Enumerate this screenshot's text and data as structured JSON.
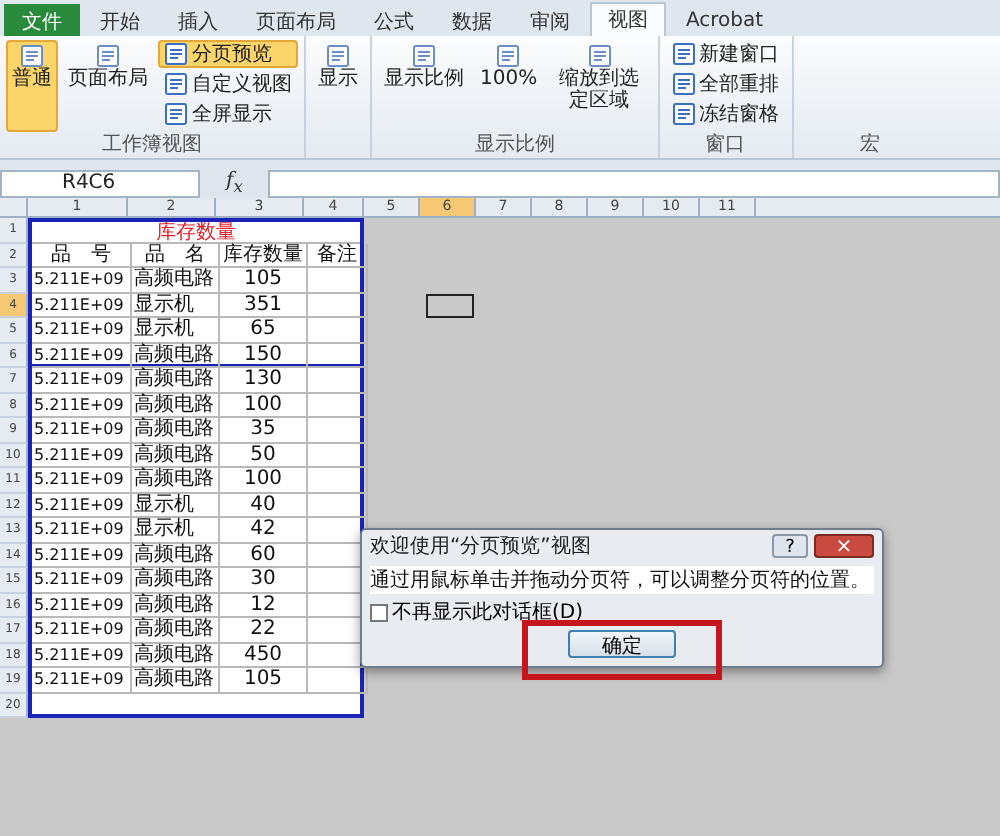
{
  "tabs": [
    {
      "label": "文件",
      "kind": "file",
      "selected": false
    },
    {
      "label": "开始",
      "kind": "tab",
      "selected": false
    },
    {
      "label": "插入",
      "kind": "tab",
      "selected": false
    },
    {
      "label": "页面布局",
      "kind": "tab",
      "selected": false
    },
    {
      "label": "公式",
      "kind": "tab",
      "selected": false
    },
    {
      "label": "数据",
      "kind": "tab",
      "selected": false
    },
    {
      "label": "审阅",
      "kind": "tab",
      "selected": false
    },
    {
      "label": "视图",
      "kind": "tab",
      "selected": true
    },
    {
      "label": "Acrobat",
      "kind": "tab",
      "selected": false
    }
  ],
  "ribbon": {
    "groups": [
      {
        "label": "工作簿视图",
        "items": [
          {
            "label": "普通",
            "kind": "large",
            "selected": true
          },
          {
            "label": "页面布局",
            "kind": "large",
            "selected": false
          },
          {
            "label": "分页预览",
            "kind": "small",
            "selected": true
          },
          {
            "label": "自定义视图",
            "kind": "small",
            "selected": false
          },
          {
            "label": "全屏显示",
            "kind": "small",
            "selected": false
          }
        ]
      },
      {
        "items": [
          {
            "label": "显示",
            "kind": "large",
            "selected": false
          }
        ]
      },
      {
        "label": "显示比例",
        "items": [
          {
            "label": "显示比例",
            "kind": "large",
            "selected": false
          },
          {
            "label": "100%",
            "kind": "large",
            "selected": false
          },
          {
            "label": "缩放到选定区域",
            "kind": "large",
            "selected": false
          }
        ]
      },
      {
        "label": "窗口",
        "items": [
          {
            "label": "新建窗口",
            "kind": "small",
            "selected": false
          },
          {
            "label": "全部重排",
            "kind": "small",
            "selected": false
          },
          {
            "label": "冻结窗格",
            "kind": "small",
            "selected": false
          }
        ]
      }
    ]
  },
  "macro_group": "宏",
  "formula_bar": {
    "name_box": "R4C6",
    "fx": "f$_{x}$"
  },
  "column_headers": [
    {
      "label": "1",
      "selected": false
    },
    {
      "label": "2",
      "selected": false
    },
    {
      "label": "3",
      "selected": false
    },
    {
      "label": "4",
      "selected": false
    },
    {
      "label": "5",
      "selected": false
    },
    {
      "label": "6",
      "selected": true
    },
    {
      "label": "7",
      "selected": false
    },
    {
      "label": "8",
      "selected": false
    },
    {
      "label": "9",
      "selected": false
    },
    {
      "label": "10",
      "selected": false
    },
    {
      "label": "11",
      "selected": false
    }
  ],
  "rows": [
    {
      "number": "1",
      "kind": "title",
      "cells": [
        "库存数量"
      ]
    },
    {
      "number": "2",
      "kind": "header",
      "cells": [
        "品　号",
        "品　名",
        "库存数量",
        "备注"
      ]
    },
    {
      "number": "3",
      "kind": "data",
      "cells": [
        "5.211E+09",
        "高频电路",
        "105",
        ""
      ]
    },
    {
      "number": "4",
      "kind": "data",
      "selected": true,
      "cells": [
        "5.211E+09",
        "显示机",
        "351",
        ""
      ]
    },
    {
      "number": "5",
      "kind": "data",
      "cells": [
        "5.211E+09",
        "显示机",
        "65",
        ""
      ]
    },
    {
      "number": "6",
      "kind": "data",
      "page_break": true,
      "cells": [
        "5.211E+09",
        "高频电路",
        "150",
        ""
      ]
    },
    {
      "number": "7",
      "kind": "data",
      "cells": [
        "5.211E+09",
        "高频电路",
        "130",
        ""
      ]
    },
    {
      "number": "8",
      "kind": "data",
      "cells": [
        "5.211E+09",
        "高频电路",
        "100",
        ""
      ]
    },
    {
      "number": "9",
      "kind": "data",
      "cells": [
        "5.211E+09",
        "高频电路",
        "35",
        ""
      ]
    },
    {
      "number": "10",
      "kind": "data",
      "cells": [
        "5.211E+09",
        "高频电路",
        "50",
        ""
      ]
    },
    {
      "number": "11",
      "kind": "data",
      "cells": [
        "5.211E+09",
        "高频电路",
        "100",
        ""
      ]
    },
    {
      "number": "12",
      "kind": "data",
      "cells": [
        "5.211E+09",
        "显示机",
        "40",
        ""
      ]
    },
    {
      "number": "13",
      "kind": "data",
      "cells": [
        "5.211E+09",
        "显示机",
        "42",
        ""
      ]
    },
    {
      "number": "14",
      "kind": "data",
      "cells": [
        "5.211E+09",
        "高频电路",
        "60",
        ""
      ]
    },
    {
      "number": "15",
      "kind": "data",
      "cells": [
        "5.211E+09",
        "高频电路",
        "30",
        ""
      ]
    },
    {
      "number": "16",
      "kind": "data",
      "cells": [
        "5.211E+09",
        "高频电路",
        "12",
        ""
      ]
    },
    {
      "number": "17",
      "kind": "data",
      "cells": [
        "5.211E+09",
        "高频电路",
        "22",
        ""
      ]
    },
    {
      "number": "18",
      "kind": "data",
      "cells": [
        "5.211E+09",
        "高频电路",
        "450",
        ""
      ]
    },
    {
      "number": "19",
      "kind": "data",
      "cells": [
        "5.211E+09",
        "高频电路",
        "105",
        ""
      ]
    },
    {
      "number": "20",
      "kind": "empty",
      "cells": []
    }
  ],
  "dialog": {
    "title": "欢迎使用“分页预览”视图",
    "help": "?",
    "close": "×",
    "message": "通过用鼠标单击并拖动分页符，可以调整分页符的位置。",
    "checkbox": {
      "label": "不再显示此对话框(D)",
      "checked": false
    },
    "button": "确定",
    "highlighted": true
  }
}
